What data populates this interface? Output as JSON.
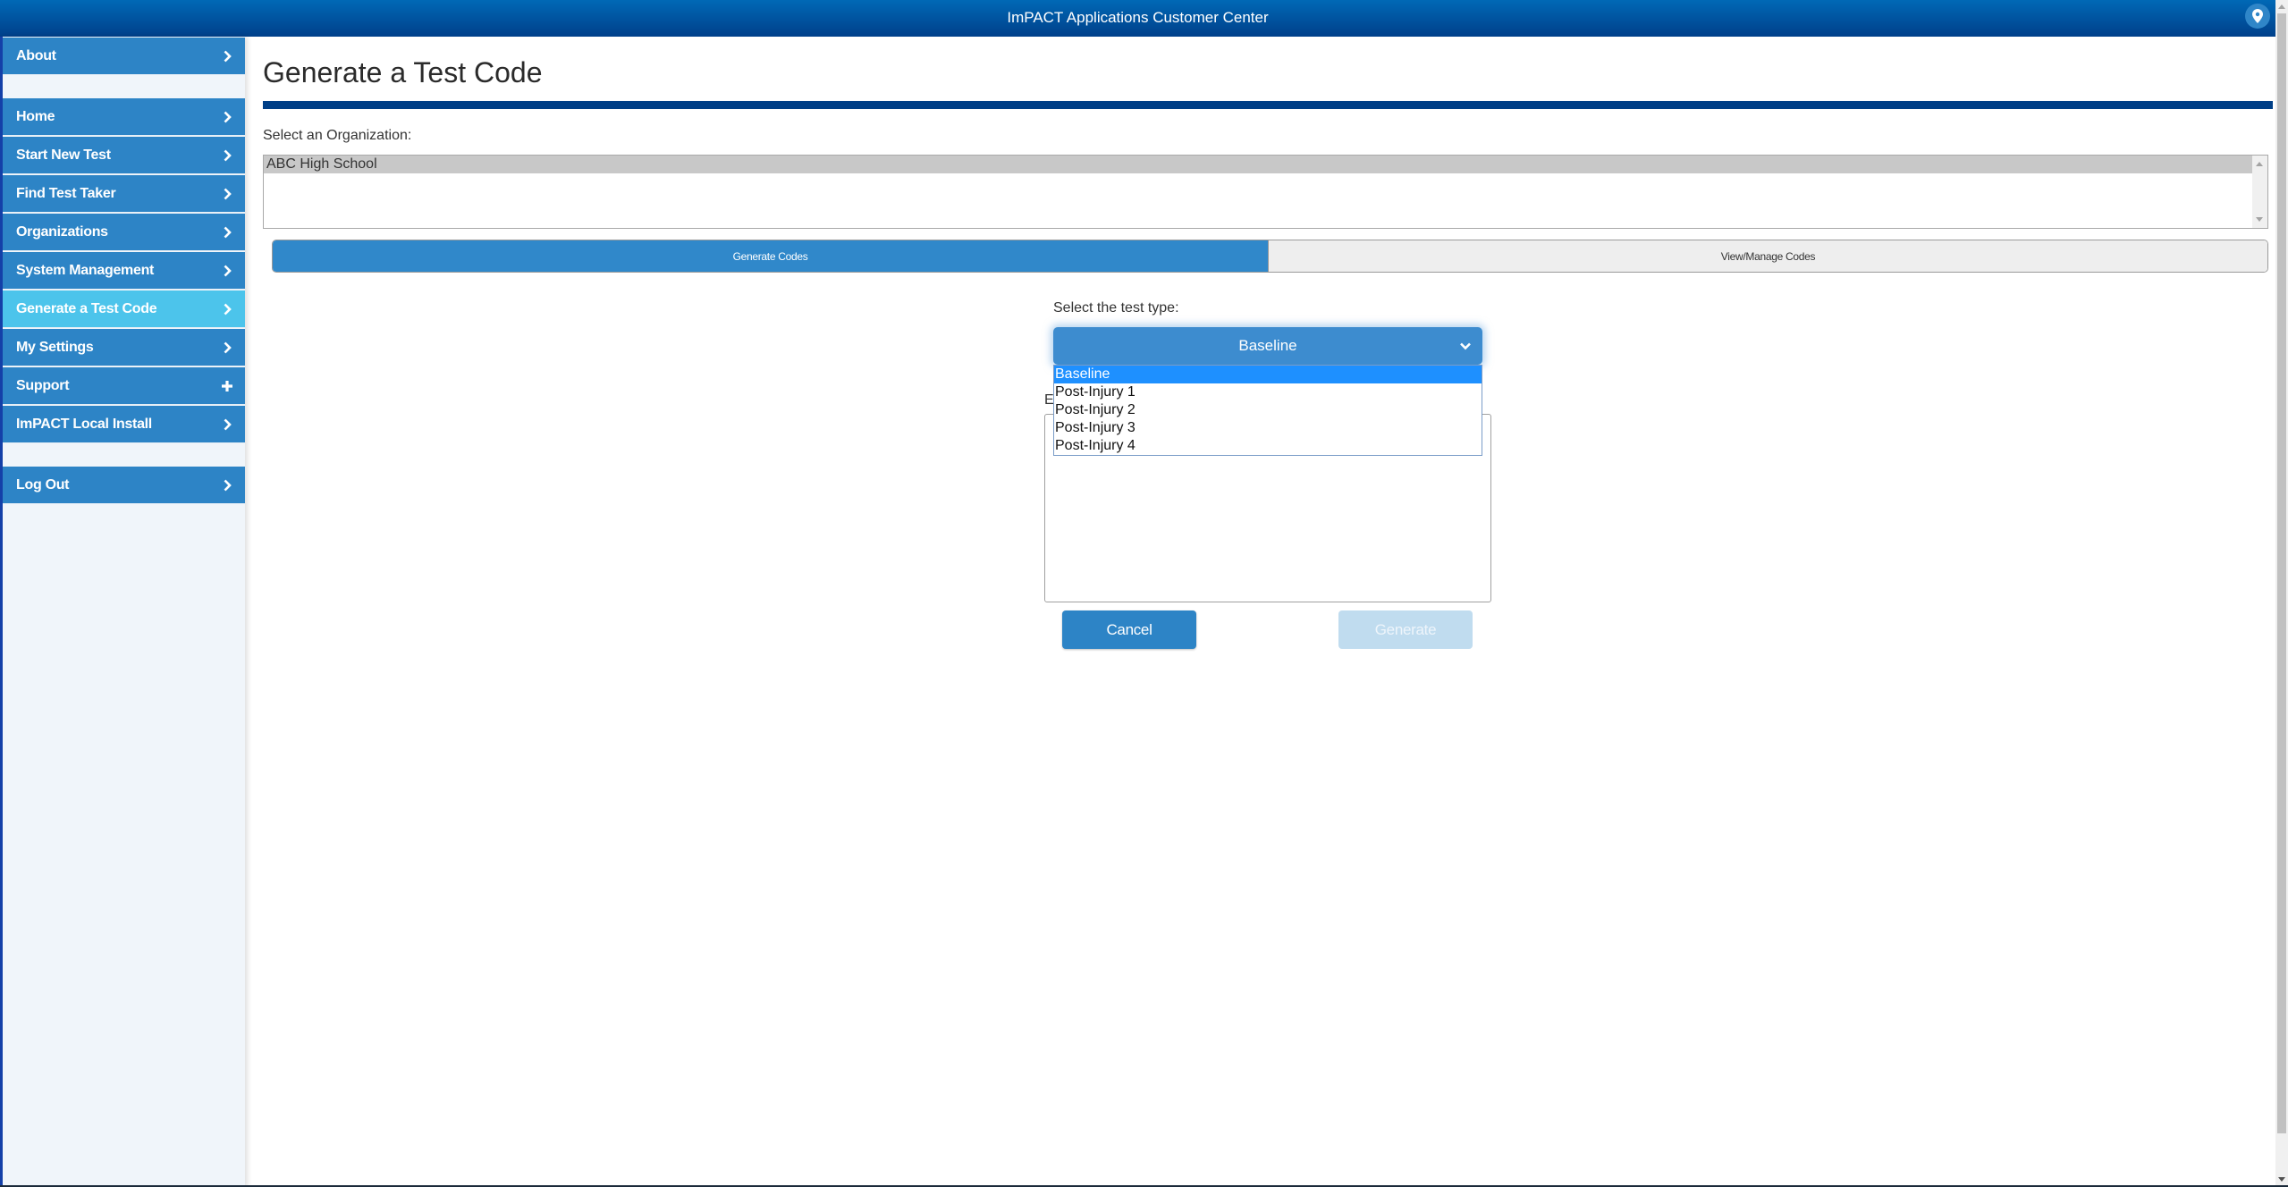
{
  "header": {
    "title": "ImPACT Applications Customer Center",
    "location_icon": "map-pin-icon"
  },
  "sidebar": {
    "items": [
      {
        "label": "About",
        "icon": "chevron-right-icon",
        "active": false
      },
      {
        "label": "Home",
        "icon": "chevron-right-icon",
        "active": false
      },
      {
        "label": "Start New Test",
        "icon": "chevron-right-icon",
        "active": false
      },
      {
        "label": "Find Test Taker",
        "icon": "chevron-right-icon",
        "active": false
      },
      {
        "label": "Organizations",
        "icon": "chevron-right-icon",
        "active": false
      },
      {
        "label": "System Management",
        "icon": "chevron-right-icon",
        "active": false
      },
      {
        "label": "Generate a Test Code",
        "icon": "chevron-right-icon",
        "active": true
      },
      {
        "label": "My Settings",
        "icon": "chevron-right-icon",
        "active": false
      },
      {
        "label": "Support",
        "icon": "plus-icon",
        "active": false
      },
      {
        "label": "ImPACT Local Install",
        "icon": "chevron-right-icon",
        "active": false
      },
      {
        "label": "Log Out",
        "icon": "chevron-right-icon",
        "active": false
      }
    ]
  },
  "main": {
    "page_title": "Generate a Test Code",
    "organization": {
      "label": "Select an Organization:",
      "options": [
        "ABC High School"
      ],
      "selected": "ABC High School"
    },
    "tabs": [
      {
        "label": "Generate Codes",
        "active": true
      },
      {
        "label": "View/Manage Codes",
        "active": false
      }
    ],
    "test_type": {
      "label": "Select the test type:",
      "selected": "Baseline",
      "options": [
        "Baseline",
        "Post-Injury 1",
        "Post-Injury 2",
        "Post-Injury 3",
        "Post-Injury 4"
      ],
      "highlighted": "Baseline"
    },
    "obscured_label_fragment": "E",
    "buttons": {
      "cancel": "Cancel",
      "generate": "Generate",
      "generate_disabled": true
    }
  },
  "colors": {
    "header_top": "#0069b6",
    "header_bottom": "#00408a",
    "nav_blue": "#2d84c6",
    "nav_active": "#4cc4eb",
    "title_rule": "#003f87",
    "dropdown_highlight": "#1e90ff",
    "generate_disabled": "#c0dcef"
  }
}
